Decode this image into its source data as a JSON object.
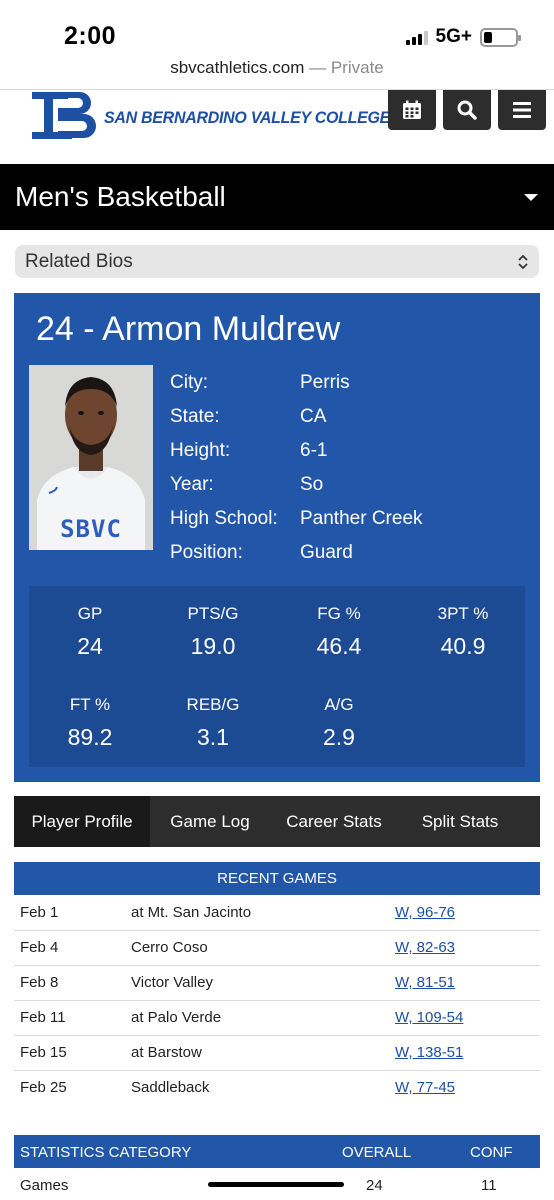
{
  "status_bar": {
    "time": "2:00",
    "network": "5G+"
  },
  "browser": {
    "domain": "sbvcathletics.com",
    "mode": "— Private"
  },
  "header": {
    "logo_text": "SAN BERNARDINO VALLEY COLLEGE",
    "buttons": [
      {
        "icon": "calendar-icon"
      },
      {
        "icon": "search-icon"
      },
      {
        "icon": "menu-icon"
      }
    ]
  },
  "sport": {
    "title": "Men's Basketball"
  },
  "related": {
    "label": "Related Bios"
  },
  "player": {
    "name": "24 - Armon Muldrew",
    "photo_jersey": "SBVC",
    "info": [
      {
        "label": "City:",
        "value": "Perris"
      },
      {
        "label": "State:",
        "value": "CA"
      },
      {
        "label": "Height:",
        "value": "6-1"
      },
      {
        "label": "Year:",
        "value": "So"
      },
      {
        "label": "High School:",
        "value": "Panther Creek"
      },
      {
        "label": "Position:",
        "value": "Guard"
      }
    ],
    "stats": [
      {
        "label": "GP",
        "value": "24"
      },
      {
        "label": "PTS/G",
        "value": "19.0"
      },
      {
        "label": "FG %",
        "value": "46.4"
      },
      {
        "label": "3PT %",
        "value": "40.9"
      },
      {
        "label": "FT %",
        "value": "89.2"
      },
      {
        "label": "REB/G",
        "value": "3.1"
      },
      {
        "label": "A/G",
        "value": "2.9"
      }
    ]
  },
  "tabs": [
    "Player Profile",
    "Game Log",
    "Career Stats",
    "Split Stats"
  ],
  "recent_games": {
    "title": "RECENT GAMES",
    "rows": [
      {
        "date": "Feb 1",
        "opponent": "at Mt. San Jacinto",
        "result": "W, 96-76"
      },
      {
        "date": "Feb 4",
        "opponent": "Cerro Coso",
        "result": "W, 82-63"
      },
      {
        "date": "Feb 8",
        "opponent": "Victor Valley",
        "result": "W, 81-51"
      },
      {
        "date": "Feb 11",
        "opponent": "at Palo Verde",
        "result": "W, 109-54"
      },
      {
        "date": "Feb 15",
        "opponent": "at Barstow",
        "result": "W, 138-51"
      },
      {
        "date": "Feb 25",
        "opponent": "Saddleback",
        "result": "W, 77-45"
      }
    ]
  },
  "statistics": {
    "headers": [
      "STATISTICS CATEGORY",
      "OVERALL",
      "CONF"
    ],
    "rows": [
      {
        "category": "Games",
        "overall": "24",
        "conf": "11"
      }
    ]
  },
  "colors": {
    "brand_blue": "#2256a8",
    "dark": "#2d2d2d"
  }
}
